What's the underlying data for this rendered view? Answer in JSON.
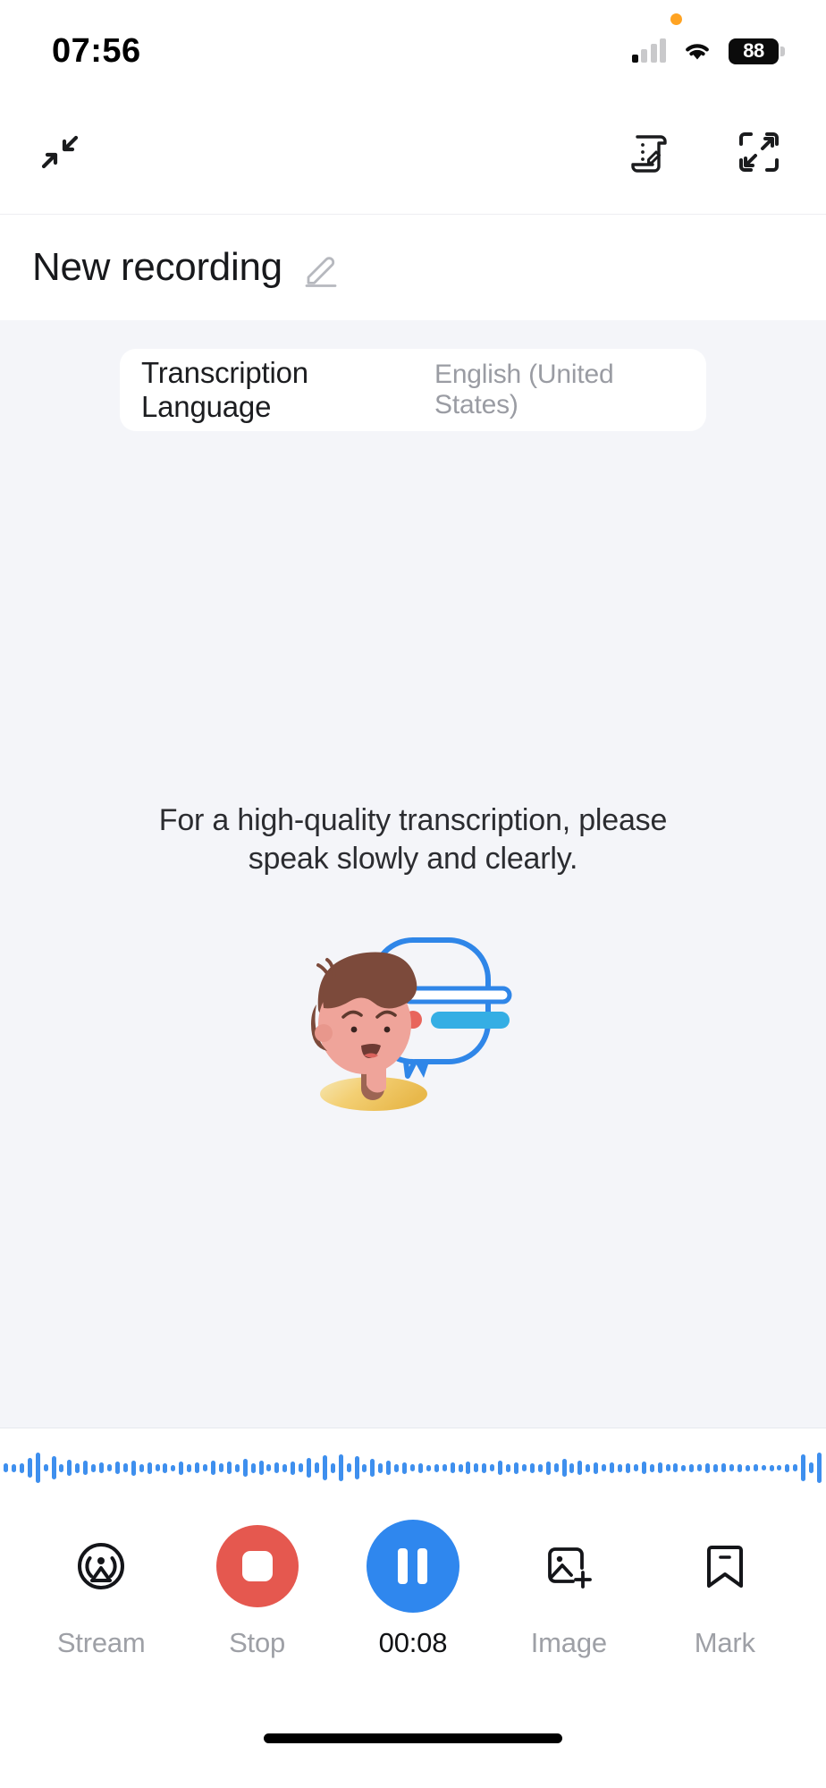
{
  "status_bar": {
    "time": "07:56",
    "battery_level": "88",
    "icons": {
      "recording_dot": "orange-recording-dot",
      "cellular": "cellular-signal-icon",
      "wifi": "wifi-icon",
      "battery": "battery-icon"
    }
  },
  "app_bar": {
    "collapse_icon": "collapse-arrows-icon",
    "notes_icon": "scroll-notes-edit-icon",
    "expand_icon": "expand-fullscreen-icon"
  },
  "title_row": {
    "title": "New recording",
    "edit_icon": "pencil-edit-icon"
  },
  "language_card": {
    "label": "Transcription Language",
    "value": "English (United States)"
  },
  "hint": {
    "line1": "For a high-quality transcription, please",
    "line2": "speak slowly and clearly.",
    "illustration": "person-speaking-bubble-illustration"
  },
  "waveform": {
    "color": "#3E8FEE",
    "heights": [
      10,
      9,
      11,
      22,
      34,
      8,
      26,
      9,
      18,
      11,
      16,
      9,
      12,
      8,
      14,
      10,
      17,
      9,
      13,
      8,
      11,
      7,
      15,
      9,
      12,
      8,
      16,
      10,
      14,
      9,
      20,
      11,
      16,
      8,
      12,
      9,
      15,
      10,
      22,
      12,
      28,
      11,
      30,
      10,
      26,
      9,
      20,
      11,
      16,
      9,
      13,
      8,
      11,
      7,
      9,
      8,
      12,
      9,
      14,
      10,
      11,
      8,
      16,
      9,
      13,
      8,
      11,
      9,
      15,
      10,
      20,
      11,
      16,
      9,
      13,
      8,
      12,
      9,
      11,
      8,
      14,
      9,
      12,
      8,
      10,
      7,
      9,
      8,
      11,
      9,
      10,
      8,
      9,
      7,
      8,
      6,
      7,
      6,
      9,
      8,
      30,
      12,
      34
    ]
  },
  "controls": {
    "items": [
      {
        "name": "stream",
        "label": "Stream",
        "icon": "broadcast-stream-icon",
        "active": false
      },
      {
        "name": "stop",
        "label": "Stop",
        "icon": "stop-record-icon",
        "active": false
      },
      {
        "name": "pause",
        "label": "00:08",
        "icon": "pause-icon",
        "active": true
      },
      {
        "name": "image",
        "label": "Image",
        "icon": "add-image-icon",
        "active": false
      },
      {
        "name": "mark",
        "label": "Mark",
        "icon": "bookmark-mark-icon",
        "active": false
      }
    ]
  },
  "colors": {
    "accent_blue": "#2F87EE",
    "stop_red": "#E5584F",
    "body_bg": "#F4F5F9",
    "muted_text": "#9EA0A6"
  },
  "home_indicator": "home-indicator-bar"
}
